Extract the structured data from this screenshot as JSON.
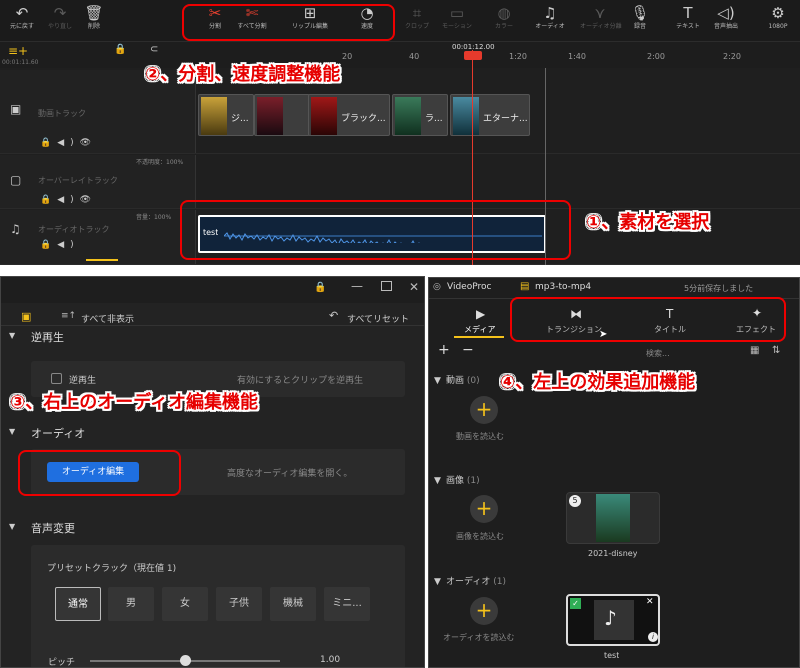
{
  "toolbar": {
    "undo": "元に戻す",
    "redo": "やり直し",
    "delete": "削除",
    "split": "分割",
    "split_all": "すべて分割",
    "ripple": "リップル編集",
    "speed": "速度",
    "crop": "クロップ",
    "mosaic": "モーション",
    "color": "カラー",
    "audio": "オーディオ",
    "audio_split": "オーディオ分離",
    "record": "録音",
    "text": "テキスト",
    "audio_extract": "音声抽出",
    "resolution": "1080P"
  },
  "timeline": {
    "playhead_time": "00:01:12.00",
    "marker_time": "00:01:11.60",
    "left_time": "00:01:11.60",
    "ticks": [
      "20",
      "40",
      "1:20",
      "1:40",
      "2:00",
      "2:20"
    ],
    "video_track": "動画トラック",
    "overlay_track": "オーバーレイトラック",
    "audio_track": "オーディオトラック",
    "overlay_opacity": "不透明度：100%",
    "audio_volume": "音量：100%",
    "audio_clip_name": "test",
    "overlay_clips": [
      "ジ...",
      "",
      "",
      "ブラック...",
      "ラ...",
      "エターナ..."
    ]
  },
  "annotations": {
    "a1": "①、素材を選択",
    "a2": "②、分割、速度調整機能",
    "a3": "③、右上のオーディオ編集機能",
    "a4": "④、左上の効果追加機能"
  },
  "left_panel": {
    "hide_all": "すべて非表示",
    "reset_all": "すべてリセット",
    "reverse_header": "逆再生",
    "reverse_checkbox": "逆再生",
    "reverse_hint": "有効にするとクリップを逆再生",
    "audio_header": "オーディオ",
    "audio_edit_button": "オーディオ編集",
    "audio_edit_hint": "高度なオーディオ編集を開く。",
    "voice_header": "音声変更",
    "preset_label": "プリセットクラック（現在値 1)",
    "presets": [
      "通常",
      "男",
      "女",
      "子供",
      "機械",
      "ミニ..."
    ],
    "pitch_label": "ピッチ",
    "pitch_value": "1.00",
    "pitch_fraction": 0.5
  },
  "right_panel": {
    "app_name": "VideoProc",
    "project_name": "mp3-to-mp4",
    "saved_status": "5分前保存しました",
    "tabs": [
      "メディア",
      "トランジション",
      "タイトル",
      "エフェクト"
    ],
    "search_placeholder": "検索...",
    "video_category": "動画",
    "video_count": "(0)",
    "video_import": "動画を読込む",
    "image_category": "画像",
    "image_count": "(1)",
    "image_import": "画像を読込む",
    "image_item": "2021-disney",
    "image_badge": "5",
    "audio_category": "オーディオ",
    "audio_count": "(1)",
    "audio_import": "オーディオを読込む",
    "audio_item": "test"
  },
  "colors": {
    "accent_red": "#e60000",
    "playhead": "#e63a2c",
    "audio_button": "#1f6fe0",
    "add_button": "#f4c21b"
  }
}
